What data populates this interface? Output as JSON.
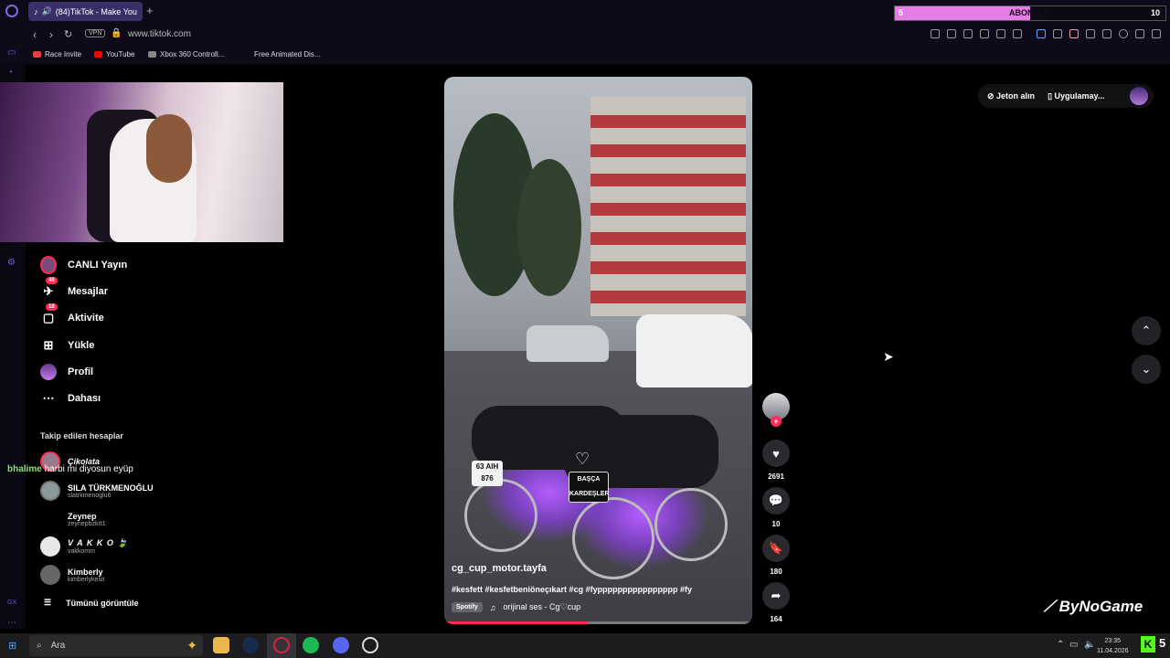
{
  "browser": {
    "tab_title": "(84)TikTok - Make You",
    "url": "www.tiktok.com",
    "vpn_label": "VPN",
    "bookmarks": [
      "Race Invite",
      "YouTube",
      "Xbox 360 Controll...",
      "Free Animated Dis..."
    ]
  },
  "stream_overlay": {
    "left_value": "5",
    "label": "ABONELIK",
    "right_value": "10",
    "progress": 0.5
  },
  "sidebar": {
    "items": [
      {
        "label": "CANLI Yayın",
        "icon": "live-avatar-icon"
      },
      {
        "label": "Mesajlar",
        "icon": "messages-icon",
        "badge": "46"
      },
      {
        "label": "Aktivite",
        "icon": "activity-icon",
        "badge": "18"
      },
      {
        "label": "Yükle",
        "icon": "upload-icon"
      },
      {
        "label": "Profil",
        "icon": "profile-avatar-icon"
      },
      {
        "label": "Dahası",
        "icon": "more-icon"
      }
    ],
    "following_title": "Takip edilen hesaplar",
    "accounts": [
      {
        "name": "Çikolata",
        "handle": ""
      },
      {
        "name": "SILA TÜRKMENOĞLU",
        "handle": "slatrkmenoglu6"
      },
      {
        "name": "Zeynep",
        "handle": "zeynepbzkrt1"
      },
      {
        "name": "V A K K O 🍃",
        "handle": "vakkomm"
      },
      {
        "name": "Kimberly",
        "handle": "kimberlykesit"
      }
    ],
    "see_all": "Tümünü görüntüle"
  },
  "chat": {
    "user": "bhalime",
    "message": "harbi mi diyosun eyüp"
  },
  "video": {
    "author": "cg_cup_motor.tayfa",
    "caption": "#kesfett #kesfetbeniöneçıkart #cg #fypppppppppppppppp #fy",
    "spotify_label": "Spotify",
    "music": "orijinal ses - Cg♡cup",
    "plate_text": "63 AIH 876",
    "sign_text": "BAŞÇA KARDEŞLER",
    "progress": 0.47
  },
  "actions": {
    "likes": "2691",
    "comments": "10",
    "saves": "180",
    "shares": "164"
  },
  "top_right": {
    "coins": "Jeton alın",
    "app": "Uygulamay..."
  },
  "watermark": "ByNoGame",
  "taskbar": {
    "search_placeholder": "Ara",
    "time": "23:35",
    "date": "11.04.2026",
    "kick_count": "5"
  },
  "colors": {
    "accent": "#fe2c55",
    "overlay": "#e27de6",
    "kick": "#53fc18"
  }
}
